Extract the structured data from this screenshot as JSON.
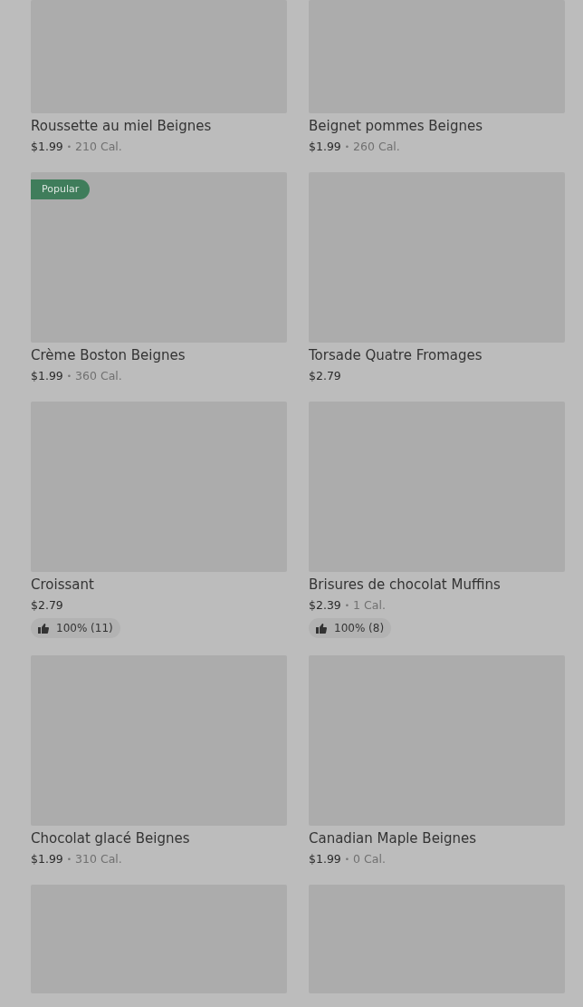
{
  "items": [
    {
      "kind": "full",
      "name": "Roussette au miel Beignes",
      "price": "$1.99",
      "separator": "•",
      "calories": "210 Cal."
    },
    {
      "kind": "full",
      "name": "Beignet pommes Beignes",
      "price": "$1.99",
      "separator": "•",
      "calories": "260 Cal."
    },
    {
      "kind": "full",
      "badge": "Popular",
      "name": "Crème Boston Beignes",
      "price": "$1.99",
      "separator": "•",
      "calories": "360 Cal."
    },
    {
      "kind": "full",
      "name": "Torsade Quatre Fromages",
      "price": "$2.79"
    },
    {
      "kind": "full",
      "name": "Croissant",
      "price": "$2.79",
      "rating": "100% (11)"
    },
    {
      "kind": "full",
      "name": "Brisures de chocolat Muffins",
      "price": "$2.39",
      "separator": "•",
      "calories": "1 Cal.",
      "rating": "100% (8)"
    },
    {
      "kind": "full",
      "name": "Chocolat glacé Beignes",
      "price": "$1.99",
      "separator": "•",
      "calories": "310 Cal."
    },
    {
      "kind": "full",
      "name": "Canadian Maple Beignes",
      "price": "$1.99",
      "separator": "•",
      "calories": "0 Cal."
    },
    {
      "kind": "image-only"
    },
    {
      "kind": "image-only"
    }
  ]
}
